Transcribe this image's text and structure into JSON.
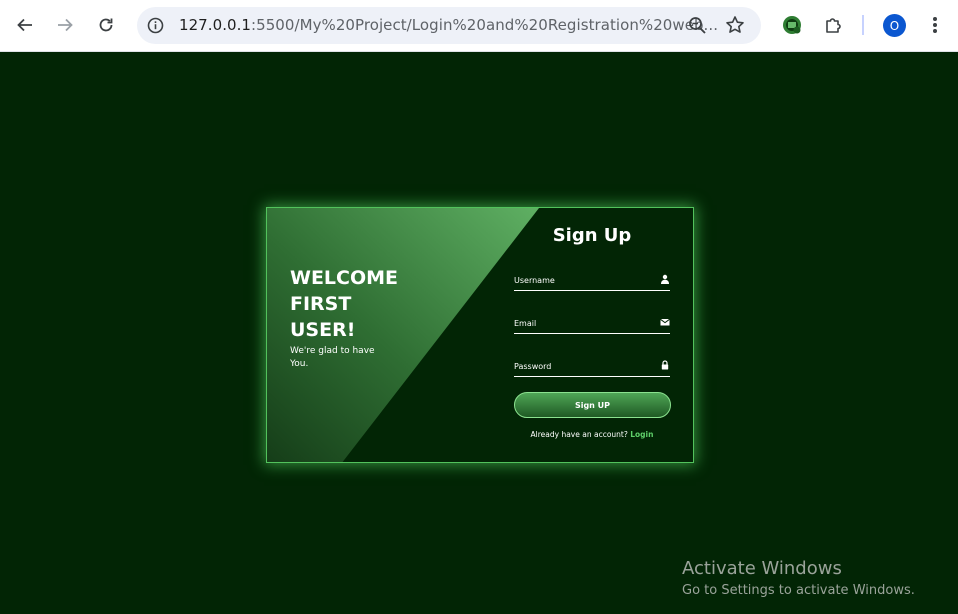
{
  "browser": {
    "url_host": "127.0.0.1",
    "url_rest": ":5500/My%20Project/Login%20and%20Registration%20web...",
    "profile_initial": "O"
  },
  "welcome": {
    "title": "WELCOME\nFIRST\nUSER!",
    "subtitle": "We're glad to have You."
  },
  "form": {
    "title": "Sign Up",
    "username_placeholder": "Username",
    "email_placeholder": "Email",
    "password_placeholder": "Password",
    "submit_label": "Sign UP",
    "login_prompt": "Already have an account?",
    "login_link": "Login"
  },
  "watermark": {
    "line1": "Activate Windows",
    "line2": "Go to Settings to activate Windows."
  },
  "colors": {
    "background": "#022505",
    "accent": "#52c25c",
    "link": "#5fd06a"
  },
  "icons": [
    "back-icon",
    "forward-icon",
    "reload-icon",
    "site-info-icon",
    "zoom-icon",
    "bookmark-star-icon",
    "extension-icon",
    "puzzle-icon",
    "more-vert-icon",
    "user-icon",
    "envelope-icon",
    "lock-icon"
  ]
}
